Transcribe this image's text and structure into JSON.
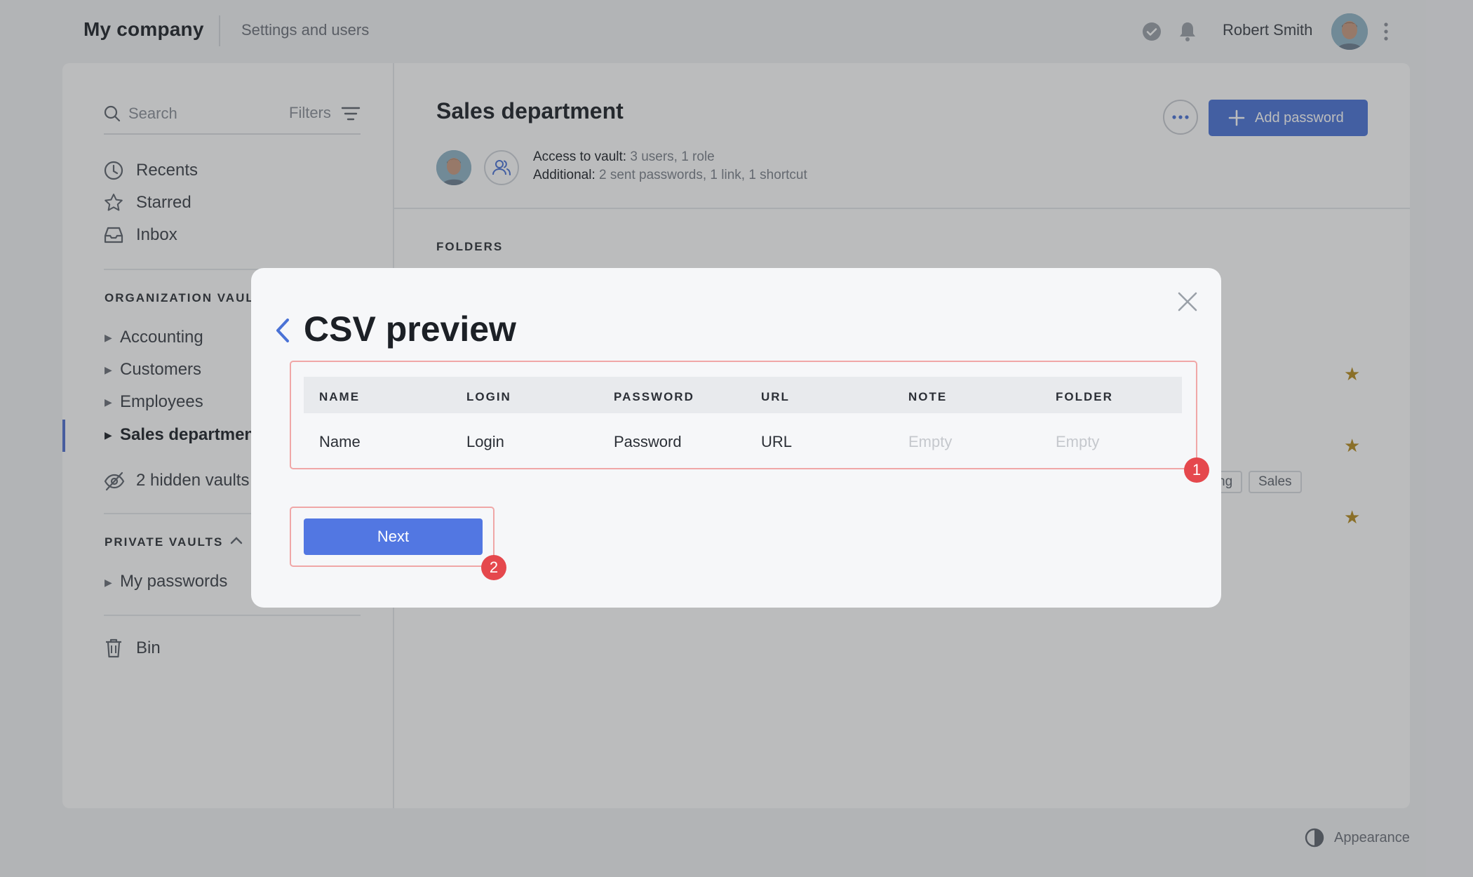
{
  "header": {
    "company": "My company",
    "settings_link": "Settings and users",
    "user_name": "Robert Smith"
  },
  "sidebar": {
    "search_placeholder": "Search",
    "filters_label": "Filters",
    "nav": [
      {
        "label": "Recents",
        "icon": "clock-icon"
      },
      {
        "label": "Starred",
        "icon": "star-icon"
      },
      {
        "label": "Inbox",
        "icon": "inbox-icon"
      }
    ],
    "org_section": "ORGANIZATION VAULTS",
    "org_vaults": [
      "Accounting",
      "Customers",
      "Employees",
      "Sales department"
    ],
    "hidden_vaults": "2 hidden vaults",
    "private_section": "PRIVATE VAULTS",
    "private_vaults": [
      "My passwords"
    ],
    "bin": "Bin"
  },
  "content": {
    "title": "Sales department",
    "add_button": "Add password",
    "access_label": "Access to vault:",
    "access_value": "3 users, 1 role",
    "additional_label": "Additional:",
    "additional_value": "2 sent passwords, 1 link, 1 shortcut",
    "folders_head": "FOLDERS",
    "tags": [
      "ng",
      "Sales"
    ]
  },
  "footer": {
    "appearance": "Appearance"
  },
  "modal": {
    "title": "CSV preview",
    "columns": [
      "NAME",
      "LOGIN",
      "PASSWORD",
      "URL",
      "NOTE",
      "FOLDER"
    ],
    "row": [
      "Name",
      "Login",
      "Password",
      "URL",
      "Empty",
      "Empty"
    ],
    "next_button": "Next",
    "badge_1": "1",
    "badge_2": "2"
  },
  "colors": {
    "accent": "#4a72d6",
    "badge": "#e5484d",
    "highlight": "#f0a7a7",
    "star": "#b58a1d"
  }
}
